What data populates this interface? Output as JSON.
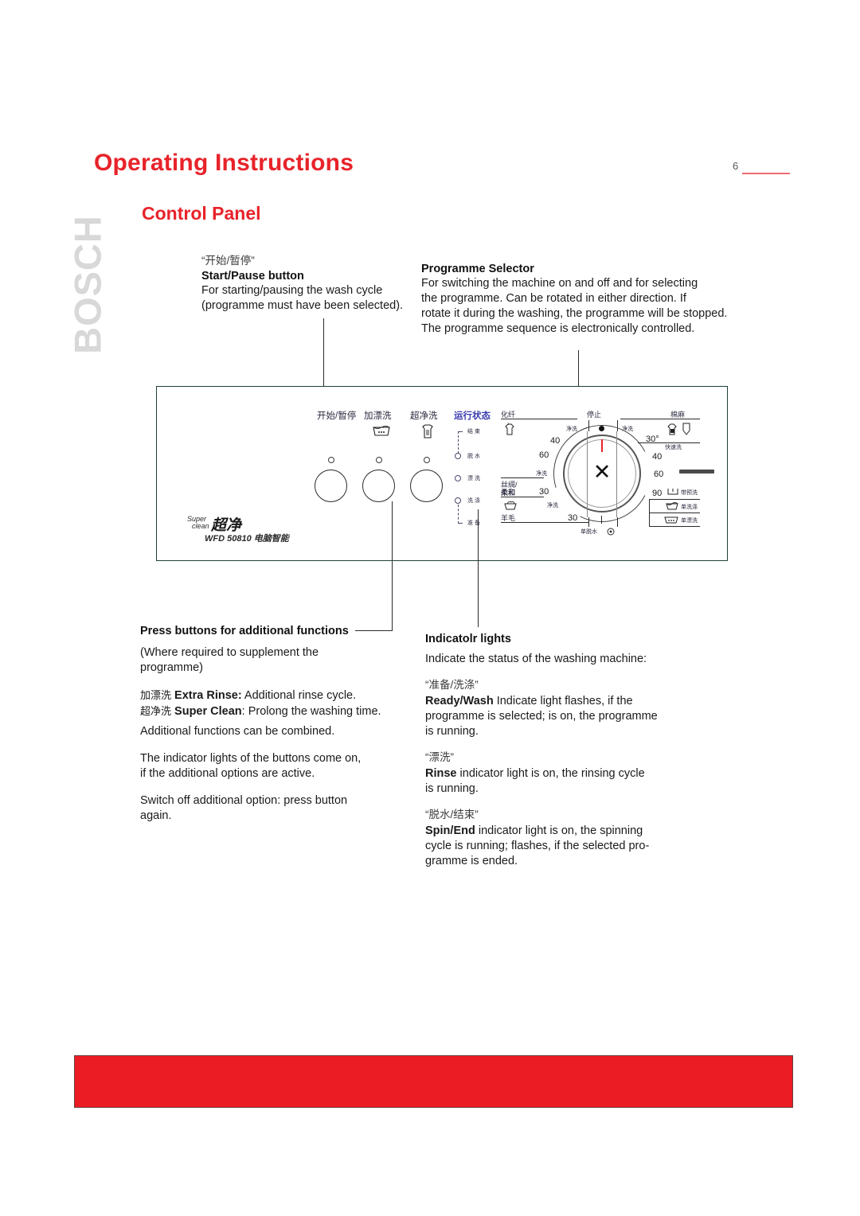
{
  "header": {
    "title": "Operating Instructions",
    "page_number": "6",
    "brand_watermark": "BOSCH",
    "section_title": "Control Panel"
  },
  "callouts": {
    "start_pause": {
      "cn_quote": "“开始/暂停”",
      "heading": "Start/Pause   button",
      "lines": [
        "For starting/pausing the wash cycle",
        "(programme must have been selected)."
      ]
    },
    "programme_selector": {
      "heading": "Programme Selector",
      "lines": [
        "For switching the machine on and off and for selecting",
        "the programme. Can be rotated in either direction. If",
        "rotate it during the washing, the programme will be stopped.",
        "The programme sequence is electronically controlled."
      ]
    },
    "additional_functions": {
      "heading": "Press buttons for additional functions",
      "sub_lines": [
        "(Where required to supplement the",
        "programme)"
      ],
      "extra_rinse_cn": "加漂洗",
      "extra_rinse_label": "Extra Rinse:",
      "extra_rinse_text": " Additional rinse cycle.",
      "super_clean_cn": "超净洗",
      "super_clean_label": "Super Clean",
      "super_clean_text": ": Prolong the washing time.",
      "combine_line": "Additional functions can be combined.",
      "indicator_lines": [
        "The indicator lights of the buttons come on,",
        "if the additional options are active."
      ],
      "switch_off_lines": [
        "Switch off additional option: press button",
        "again."
      ]
    },
    "indicator_lights": {
      "heading": "Indicatolr lights",
      "intro": "Indicate the status of the washing machine:",
      "ready_cn": "“准备/洗涤”",
      "ready_label": "Ready/Wash",
      "ready_lines": [
        " Indicate light flashes, if the",
        "programme is selected; is on, the programme",
        "is running."
      ],
      "rinse_cn": "“漂洗”",
      "rinse_label": "Rinse",
      "rinse_lines": [
        " indicator light is on, the rinsing cycle",
        "is running."
      ],
      "spin_cn": "“脱水/结束”",
      "spin_label": "Spin/End",
      "spin_lines": [
        " indicator light is on, the spinning",
        "cycle is running; flashes, if the selected pro-",
        "gramme is ended."
      ]
    }
  },
  "panel": {
    "buttons": [
      {
        "cn": "开始/暂停",
        "icon": "none"
      },
      {
        "cn": "加漂洗",
        "icon": "rinse-tub-icon"
      },
      {
        "cn": "超净洗",
        "icon": "shirt-icon"
      }
    ],
    "status_header": "运行状态",
    "status_items": [
      "结 束",
      "脱 水",
      "漂 洗",
      "洗 涤",
      "准 备"
    ],
    "brand_super": "Super",
    "brand_clean": "clean",
    "brand_cn": "超净",
    "model": "WFD 50810 电脑智能",
    "dial": {
      "top_left": "化纤",
      "top_center": "停止",
      "top_right": "棉麻",
      "left_mid": "丝绸/",
      "left_mid2": "柔和",
      "left_bottom": "羊毛",
      "center_mark": "✕",
      "cold_left_a": "净洗",
      "cold_left_b": "净洗",
      "cold_left_c": "净洗",
      "cold_right": "净洗",
      "temps_left": [
        "40",
        "60",
        "30",
        "30"
      ],
      "temps_right": [
        "30°",
        "40",
        "60",
        "90"
      ],
      "quick_wash": "快速洗",
      "prewash": "带预洗",
      "wash_only": "单洗涤",
      "rinse_only": "单漂洗",
      "spin_only": "单脱水"
    }
  },
  "colors": {
    "brand_red": "#e8232a",
    "footer_red": "#ec1c24",
    "watermark_gray": "#d8d8d8",
    "status_blue": "#3a3ab0"
  }
}
